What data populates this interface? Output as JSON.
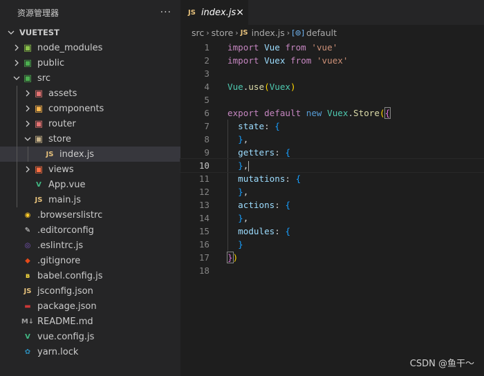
{
  "explorer": {
    "title": "资源管理器",
    "more": "···",
    "root": "VUETEST",
    "items": [
      {
        "label": "node_modules",
        "icon": "node-modules-folder-icon",
        "glyph": "▣",
        "color": "#8bc34a",
        "depth": 1,
        "chevron": "right"
      },
      {
        "label": "public",
        "icon": "public-folder-icon",
        "glyph": "▣",
        "color": "#4caf50",
        "depth": 1,
        "chevron": "right"
      },
      {
        "label": "src",
        "icon": "src-folder-icon",
        "glyph": "▣",
        "color": "#4caf50",
        "depth": 1,
        "chevron": "down"
      },
      {
        "label": "assets",
        "icon": "assets-folder-icon",
        "glyph": "▣",
        "color": "#e57373",
        "depth": 2,
        "chevron": "right"
      },
      {
        "label": "components",
        "icon": "components-folder-icon",
        "glyph": "▣",
        "color": "#ffb74d",
        "depth": 2,
        "chevron": "right"
      },
      {
        "label": "router",
        "icon": "router-folder-icon",
        "glyph": "▣",
        "color": "#e57373",
        "depth": 2,
        "chevron": "right"
      },
      {
        "label": "store",
        "icon": "store-folder-icon",
        "glyph": "▣",
        "color": "#c8b38a",
        "depth": 2,
        "chevron": "down"
      },
      {
        "label": "index.js",
        "icon": "js-file-icon",
        "glyph": "JS",
        "color": "#e5c07b",
        "depth": 3,
        "chevron": "none",
        "selected": true
      },
      {
        "label": "views",
        "icon": "views-folder-icon",
        "glyph": "▣",
        "color": "#ff7043",
        "depth": 2,
        "chevron": "right"
      },
      {
        "label": "App.vue",
        "icon": "vue-file-icon",
        "glyph": "V",
        "color": "#41b883",
        "depth": 2,
        "chevron": "none"
      },
      {
        "label": "main.js",
        "icon": "js-file-icon",
        "glyph": "JS",
        "color": "#e5c07b",
        "depth": 2,
        "chevron": "none"
      },
      {
        "label": ".browserslistrc",
        "icon": "browserslist-icon",
        "glyph": "◉",
        "color": "#ffca28",
        "depth": 1,
        "chevron": "none"
      },
      {
        "label": ".editorconfig",
        "icon": "editorconfig-icon",
        "glyph": "✎",
        "color": "#e0e0e0",
        "depth": 1,
        "chevron": "none"
      },
      {
        "label": ".eslintrc.js",
        "icon": "eslint-icon",
        "glyph": "◎",
        "color": "#7e57c2",
        "depth": 1,
        "chevron": "none"
      },
      {
        "label": ".gitignore",
        "icon": "git-icon",
        "glyph": "◆",
        "color": "#e64a19",
        "depth": 1,
        "chevron": "none"
      },
      {
        "label": "babel.config.js",
        "icon": "babel-icon",
        "glyph": "ʙ",
        "color": "#f9dc3e",
        "depth": 1,
        "chevron": "none"
      },
      {
        "label": "jsconfig.json",
        "icon": "jsconfig-icon",
        "glyph": "JS",
        "color": "#e5c07b",
        "depth": 1,
        "chevron": "none"
      },
      {
        "label": "package.json",
        "icon": "npm-icon",
        "glyph": "▬",
        "color": "#cb3837",
        "depth": 1,
        "chevron": "none"
      },
      {
        "label": "README.md",
        "icon": "markdown-icon",
        "glyph": "M↓",
        "color": "#9e9e9e",
        "depth": 1,
        "chevron": "none"
      },
      {
        "label": "vue.config.js",
        "icon": "vue-config-icon",
        "glyph": "V",
        "color": "#41b883",
        "depth": 1,
        "chevron": "none"
      },
      {
        "label": "yarn.lock",
        "icon": "yarn-icon",
        "glyph": "✿",
        "color": "#2c8ebb",
        "depth": 1,
        "chevron": "none"
      }
    ]
  },
  "tab": {
    "type": "JS",
    "name": "index.js",
    "close": "×"
  },
  "breadcrumb": {
    "parts": [
      "src",
      "store"
    ],
    "file_type": "JS",
    "file": "index.js",
    "symbol": "default"
  },
  "editor": {
    "active_line": 10,
    "line_numbers": [
      "1",
      "2",
      "3",
      "4",
      "5",
      "6",
      "7",
      "8",
      "9",
      "10",
      "11",
      "12",
      "13",
      "14",
      "15",
      "16",
      "17",
      "18"
    ]
  },
  "watermark": "CSDN @鱼干～"
}
